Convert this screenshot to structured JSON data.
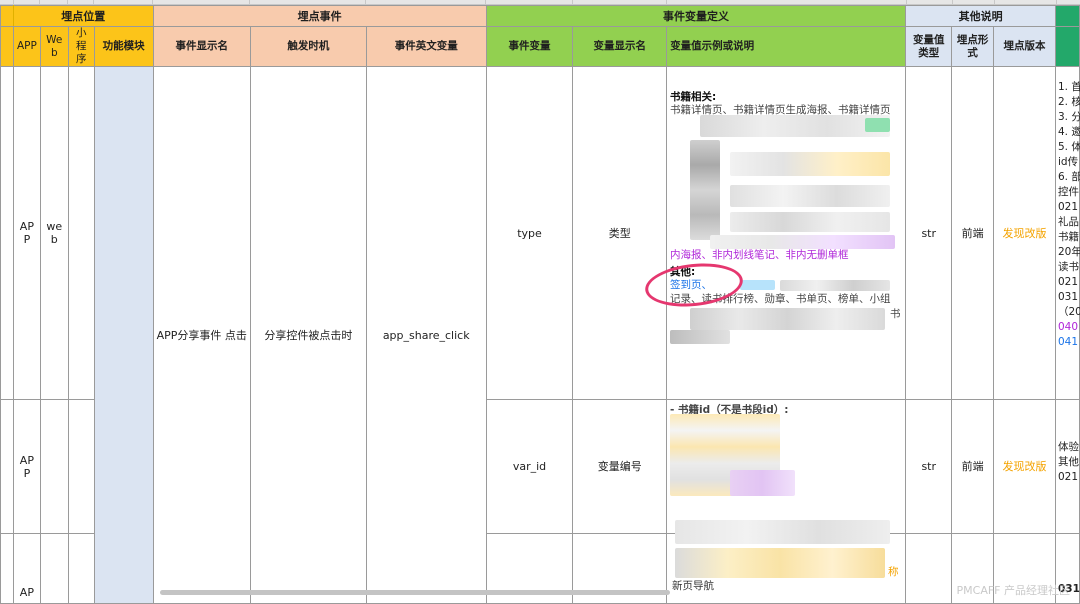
{
  "groups": {
    "location": "埋点位置",
    "event": "埋点事件",
    "var_def": "事件变量定义",
    "other": "其他说明"
  },
  "headers": {
    "app": "APP",
    "web": "Web",
    "mini": "小程序",
    "func": "功能模块",
    "event_name": "事件显示名",
    "trigger": "触发时机",
    "event_en": "事件英文变量",
    "var": "事件变量",
    "var_name": "变量显示名",
    "var_desc": "变量值示例或说明",
    "val_type": "变量值类型",
    "form": "埋点形式",
    "version": "埋点版本"
  },
  "event": {
    "display_name": "APP分享事件 点击",
    "trigger": "分享控件被点击时",
    "en_var": "app_share_click"
  },
  "rows": [
    {
      "app": "APP",
      "web": "web",
      "var": "type",
      "var_name": "类型",
      "val_type": "str",
      "form": "前端",
      "version": "发现改版",
      "desc": {
        "h1": "书籍相关:",
        "l1": "书籍详情页、书籍详情页生成海报、书籍详情页",
        "l8": "内海报、非内划线笔记、非内无删单框",
        "h2": "其他:",
        "l9": "签到页、",
        "l10": "记录、读书排行榜、勋章、书单页、榜单、小组",
        "l11": "书"
      },
      "notes": [
        "1. 首",
        "2. 核",
        "3. 分",
        "4. 邀",
        "5. 体",
        "id传",
        "6. 部",
        "控件",
        "021",
        "礼品",
        "书籍",
        "20年",
        "读书",
        "021",
        "031",
        "（20",
        "040",
        "041"
      ]
    },
    {
      "app": "APP",
      "web": "",
      "var": "var_id",
      "var_name": "变量编号",
      "val_type": "str",
      "form": "前端",
      "version": "发现改版",
      "desc": {
        "l1": "- 书籍id（不是书段id）:"
      },
      "notes": [
        "体验",
        "其他",
        "021"
      ]
    },
    {
      "app": "AP",
      "web": "",
      "var": "",
      "var_name": "",
      "val_type": "",
      "form": "",
      "version": "",
      "desc": {
        "l1": "称",
        "l2": "新页导航"
      },
      "notes": [
        "031"
      ]
    }
  ],
  "watermark": "PMCAFF 产品经理社区",
  "colors": {
    "yellow": "#fcc419",
    "peach": "#f8cbad",
    "green": "#92d050",
    "blue": "#dbe4f2",
    "orange_text": "#f4a300",
    "circle": "#e5376f"
  }
}
